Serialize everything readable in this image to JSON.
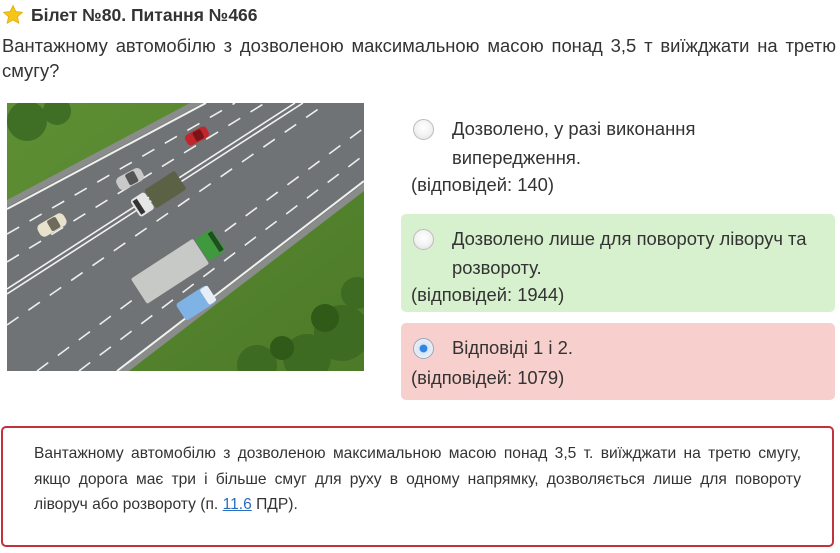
{
  "header": {
    "title": "Білет №80. Питання №466",
    "icon": "star-icon"
  },
  "question": {
    "text": "Вантажному автомобілю з дозволеною максимальною масою понад 3,5 т виїжджати на третю смугу?"
  },
  "answers": [
    {
      "text": "Дозволено, у разі виконання випередження.",
      "count": "(відповідей: 140)",
      "state": "neutral",
      "selected": false
    },
    {
      "text": "Дозволено лише для повороту ліворуч та розвороту.",
      "count": "(відповідей: 1944)",
      "state": "correct",
      "selected": false
    },
    {
      "text": "Відповіді 1 і 2.",
      "count": "(відповідей: 1079)",
      "state": "wrong",
      "selected": true
    }
  ],
  "explanation": {
    "text_before": "Вантажному автомобілю з дозволеною максимальною масою понад 3,5 т. виїжджати на третю смугу, якщо дорога має три і більше смуг для руху в одному напрямку, дозволяється лише для повороту ліворуч або розвороту (п. ",
    "link": "11.6",
    "text_after": " ПДР)."
  },
  "colors": {
    "correct_bg": "#d7f0cd",
    "wrong_bg": "#f7cfcc",
    "explanation_border": "#c0333a",
    "link": "#2a6ebd",
    "star": "#f5c518"
  }
}
